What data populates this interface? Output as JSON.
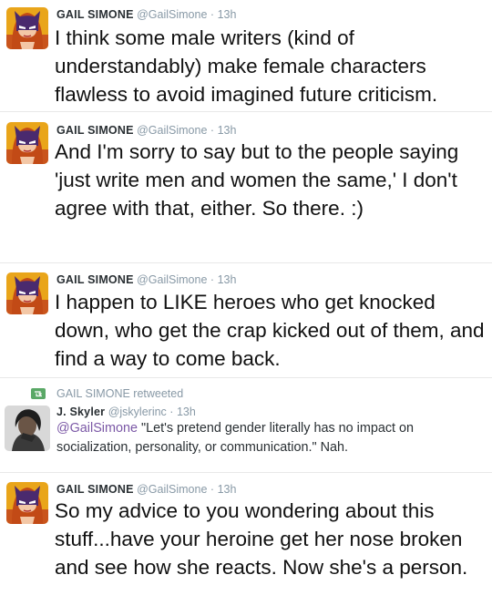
{
  "tweets": [
    {
      "name": "GAIL SIMONE",
      "handle": "@GailSimone",
      "dot": "·",
      "time": "13h",
      "text": "I think some male writers (kind of understandably) make female characters flawless to avoid imagined future criticism."
    },
    {
      "name": "GAIL SIMONE",
      "handle": "@GailSimone",
      "dot": "·",
      "time": "13h",
      "text": "And I'm sorry to say but to the people saying 'just write men and women the same,' I don't agree with that, either. So there. :)"
    },
    {
      "name": "GAIL SIMONE",
      "handle": "@GailSimone",
      "dot": "·",
      "time": "13h",
      "text": "I happen to LIKE heroes who get knocked down, who get the crap kicked out of them, and find a way to come back."
    },
    {
      "retweet_label": "GAIL SIMONE retweeted",
      "name": "J. Skyler",
      "handle": "@jskylerinc",
      "dot": "·",
      "time": "13h",
      "mention": "@GailSimone",
      "text": " \"Let's pretend gender literally has no impact on socialization, personality, or communication.\" Nah."
    },
    {
      "name": "GAIL SIMONE",
      "handle": "@GailSimone",
      "dot": "·",
      "time": "13h",
      "text": "So my advice to you wondering about this stuff...have your heroine get her nose broken and see how she reacts. Now she's a person."
    }
  ],
  "colors": {
    "name": "#292f33",
    "meta": "#8899a6",
    "mention": "#7b58a6",
    "retweet_icon": "#5aa866"
  },
  "icons": {
    "avatar": "batgirl-avatar-icon",
    "retweet": "retweet-icon",
    "small_avatar": "user-avatar-icon"
  }
}
